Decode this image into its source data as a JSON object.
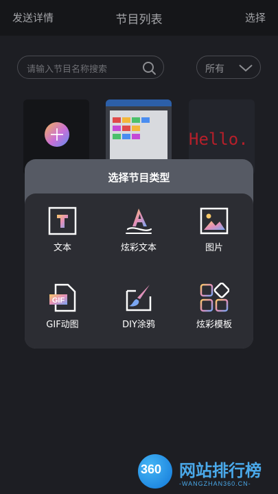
{
  "header": {
    "left_label": "发送详情",
    "title": "节目列表",
    "right_label": "选择"
  },
  "search": {
    "placeholder": "请输入节目名称搜索"
  },
  "filter": {
    "selected": "所有"
  },
  "thumbnails": {
    "hello_text": "Hello."
  },
  "modal": {
    "title": "选择节目类型",
    "options": [
      {
        "label": "文本",
        "icon": "text-icon"
      },
      {
        "label": "炫彩文本",
        "icon": "color-text-icon"
      },
      {
        "label": "图片",
        "icon": "image-icon"
      },
      {
        "label": "GIF动图",
        "icon": "gif-icon"
      },
      {
        "label": "DIY涂鸦",
        "icon": "brush-icon"
      },
      {
        "label": "炫彩模板",
        "icon": "template-icon"
      }
    ]
  },
  "watermark": {
    "logo_number": "360",
    "site_name": "网站排行榜",
    "domain": "-WANGZHAN360.CN-"
  }
}
